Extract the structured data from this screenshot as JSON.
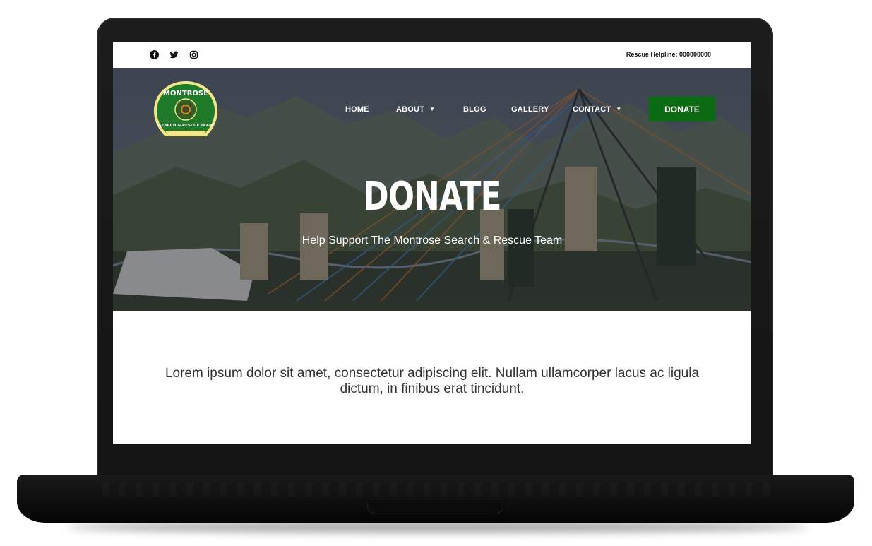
{
  "topbar": {
    "social_icons": [
      "facebook-icon",
      "twitter-icon",
      "instagram-icon"
    ],
    "helpline": "Rescue Helpline: 000000000"
  },
  "logo": {
    "top_text": "MONTROSE",
    "bottom_text": "SEARCH & RESCUE TEAM"
  },
  "nav": {
    "items": [
      {
        "label": "HOME",
        "has_dropdown": false
      },
      {
        "label": "ABOUT",
        "has_dropdown": true
      },
      {
        "label": "BLOG",
        "has_dropdown": false
      },
      {
        "label": "GALLERY",
        "has_dropdown": false
      },
      {
        "label": "CONTACT",
        "has_dropdown": true
      }
    ],
    "donate_label": "DONATE"
  },
  "hero": {
    "title": "DONATE",
    "subtitle": "Help Support The Montrose Search & Rescue Team"
  },
  "main": {
    "body": "Lorem ipsum dolor sit amet, consectetur adipiscing elit. Nullam ullamcorper lacus ac ligula dictum, in finibus erat tincidunt."
  },
  "colors": {
    "accent_green": "#0b6b12",
    "text_dark": "#333333",
    "white": "#ffffff"
  }
}
